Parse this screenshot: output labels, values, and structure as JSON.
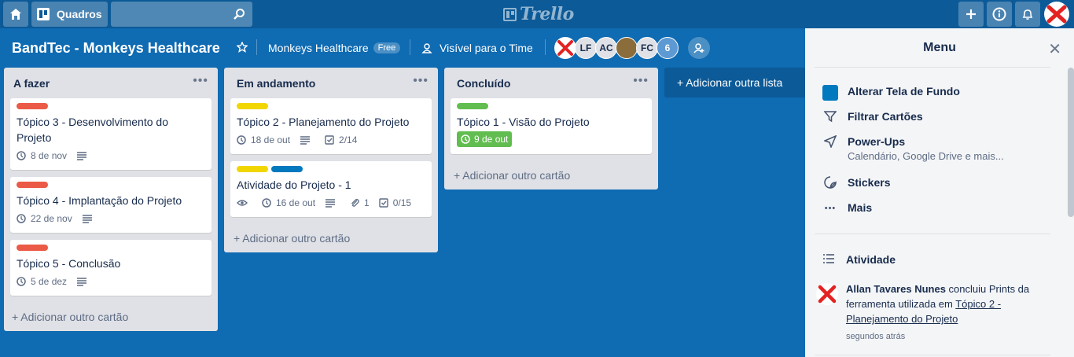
{
  "topbar": {
    "home_icon": "home-icon",
    "boards_label": "Quadros",
    "search_placeholder": "",
    "logo_text": "Trello",
    "icons": [
      "plus-icon",
      "info-icon",
      "bell-icon",
      "avatar-x-icon"
    ]
  },
  "board": {
    "title": "BandTec - Monkeys Healthcare",
    "team": "Monkeys Healthcare",
    "team_badge": "Free",
    "visibility": "Visível para o Time",
    "members": [
      "LF",
      "AC",
      "FC"
    ],
    "member_count": "6"
  },
  "colors": {
    "red": "#eb5a46",
    "yellow": "#f2d600",
    "blue": "#0079bf",
    "green": "#61bd4f"
  },
  "lists": [
    {
      "title": "A fazer",
      "add_card": "+ Adicionar outro cartão",
      "cards": [
        {
          "title": "Tópico 3 - Desenvolvimento do Projeto",
          "labels": [
            "red"
          ],
          "due": "8 de nov"
        },
        {
          "title": "Tópico 4 - Implantação do Projeto",
          "labels": [
            "red"
          ],
          "due": "22 de nov"
        },
        {
          "title": "Tópico 5 - Conclusão",
          "labels": [
            "red"
          ],
          "due": "5 de dez"
        }
      ]
    },
    {
      "title": "Em andamento",
      "add_card": "+ Adicionar outro cartão",
      "cards": [
        {
          "title": "Tópico 2 - Planejamento do Projeto",
          "labels": [
            "yellow"
          ],
          "due": "18 de out",
          "checklist": "2/14"
        },
        {
          "title": "Atividade do Projeto - 1",
          "labels": [
            "yellow",
            "blue"
          ],
          "due": "16 de out",
          "attachments": "1",
          "checklist": "0/15"
        }
      ]
    },
    {
      "title": "Concluído",
      "add_card": "+ Adicionar outro cartão",
      "cards": [
        {
          "title": "Tópico 1 - Visão do Projeto",
          "labels": [
            "green"
          ],
          "due": "9 de out"
        }
      ]
    }
  ],
  "add_list": "+ Adicionar outra lista",
  "menu": {
    "title": "Menu",
    "items": [
      {
        "label": "Alterar Tela de Fundo",
        "icon": "background-swatch-icon"
      },
      {
        "label": "Filtrar Cartões",
        "icon": "filter-icon"
      },
      {
        "label": "Power-Ups",
        "sub": "Calendário, Google Drive e mais...",
        "icon": "rocket-icon"
      },
      {
        "label": "Stickers",
        "icon": "sticker-icon"
      },
      {
        "label": "Mais",
        "icon": "more-icon"
      }
    ],
    "activity_title": "Atividade",
    "activity": {
      "user": "Allan Tavares Nunes",
      "text": " concluiu Prints da ferramenta utilizada em ",
      "link": "Tópico 2 - Planejamento do Projeto",
      "time": "segundos atrás"
    }
  }
}
